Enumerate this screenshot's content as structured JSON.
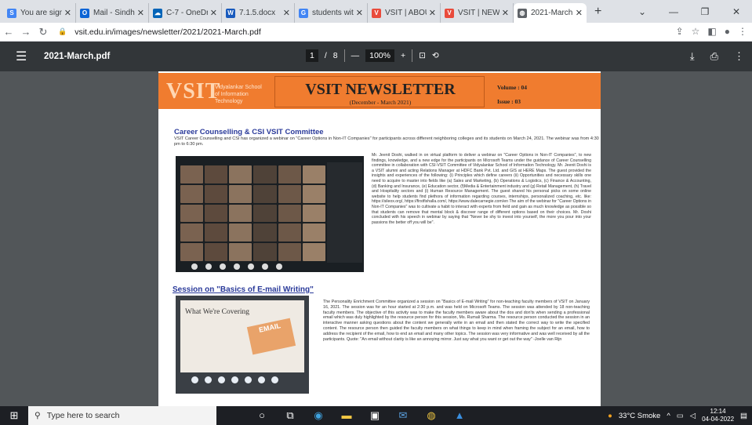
{
  "browser": {
    "tabs": [
      {
        "label": "You are signe",
        "icon": "S",
        "color": "#4285f4",
        "active": false
      },
      {
        "label": "Mail - Sindh",
        "icon": "O",
        "color": "#0a64d6",
        "active": false
      },
      {
        "label": "C-7 - OneDri",
        "icon": "☁",
        "color": "#0364b8",
        "active": false
      },
      {
        "label": "7.1.5.docx",
        "icon": "W",
        "color": "#185abd",
        "active": false
      },
      {
        "label": "students wit",
        "icon": "G",
        "color": "#4285f4",
        "active": false
      },
      {
        "label": "VSIT | ABOUT",
        "icon": "V",
        "color": "#e94b3c",
        "active": false
      },
      {
        "label": "VSIT | NEWSL",
        "icon": "V",
        "color": "#e94b3c",
        "active": false
      },
      {
        "label": "2021-March",
        "icon": "◍",
        "color": "#5f6368",
        "active": true
      }
    ],
    "newtab": "+",
    "url": "vsit.edu.in/images/newsletter/2021/2021-March.pdf"
  },
  "pdf": {
    "filename": "2021-March.pdf",
    "page_current": "1",
    "page_sep": "/",
    "page_total": "8",
    "zoom": "100%"
  },
  "newsletter": {
    "logo": "VSIT",
    "logo_sub": "Vidyalankar School of Information Technology",
    "title": "VSIT NEWSLETTER",
    "period": "(December - March 2021)",
    "volume": "Volume : 04",
    "issue": "Issue : 03",
    "s1_heading": "Career Counselling & CSI VSIT Committee",
    "s1_intro": "VSIT Career Counselling and CSI has organized a webinar on \"Career Options in Non-IT Companies\" for participants across different neighboring colleges and its students on March 24, 2021. The webinar was from 4:30 pm to 6:30 pm.",
    "s1_body": "Mr. Jeenit Doshi, walked in on virtual platform to deliver a webinar on \"Career Options in Non-IT Companies\", to new findings, knowledge, and a new edge for the participants on Microsoft Teams under the guidance of Career Counselling committee in collaboration with CSI-VSIT Committee of Vidyalankar School of Information Technology. Mr. Jeenit Doshi is a VSIT alumni and acting Relations Manager at HDFC Bank Pvt. Ltd. and GIS at HERE Maps. The guest provided the insights and experiences of the following: (i) Principles which define careers (ii) Opportunities and necessary skills one need to acquire to master into fields like (a) Sales and Marketing, (b) Operations & Logistics, (c) Finance & Accounting, (d) Banking and Insurance, (e) Education sector, (f)Media & Entertainment industry and (g) Retail Management, (h) Travel and Hospitality sectors and (i) Human Resource Management. The guest shared his personal picks on some online website to help students find plethora of information regarding courses, internships, personalized coaching, etc. like: https://sileox.org/, https://firstfishalla.com/, https://www.dalecarnegie.com/en The aim of the webinar for \"Career Options in Non-IT Companies\" was to cultivate a habit to interact with experts from field and gain as much knowledge as possible so that students can remove that mental block & discover range of different options based on their choices. Mr. Doshi concluded with his speech in webinar by saying that \"Never be shy to invest into yourself, the more you pour into your passions the better off you will be\".",
    "s2_heading": "Session on \"Basics of E-mail Writing\"",
    "slide_title": "What We're Covering",
    "slide_email": "EMAIL",
    "s2_body": "The Personality Enrichment Committee organized a session on \"Basics of E-mail Writing\" for non-teaching faculty members of VSIT on January 16, 2021. The session was for an hour started at 2:30 p.m. and was held on Microsoft Teams. The session was attended by 18 non-teaching faculty members. The objective of this activity was to make the faculty members aware about the dos and don'ts when sending a professional email which was duly highlighted by the resource person for this session, Ms. Rumali Sharma. The resource person conducted the session in an interactive manner asking questions about the content we generally write in an email and then stated the correct way to write the specified content. The resource person then guided the faculty members on what things to keep in mind when framing the subject for an email, how to address the recipient of the email, how to end an email and many other topics. The session was very informative and was well received by all the participants. Quote: \"An email without clarity is like an annoying mirror. Just say what you want or get out the way\" -Joelle van Rijn"
  },
  "taskbar": {
    "search_placeholder": "Type here to search",
    "weather": "33°C Smoke",
    "time": "12:14",
    "date": "04-04-2022"
  }
}
